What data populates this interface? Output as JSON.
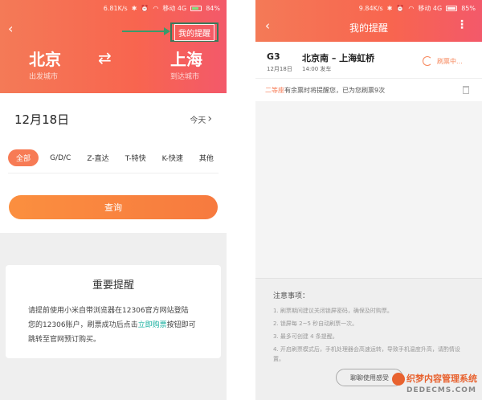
{
  "left": {
    "status": {
      "speed": "6.81K/s",
      "network": "移动 4G",
      "battery": "84%"
    },
    "header": {
      "remind_button": "我的提醒",
      "from_city": "北京",
      "from_label": "出发城市",
      "to_city": "上海",
      "to_label": "到达城市",
      "swap_icon": "⇄"
    },
    "date": {
      "value": "12月18日",
      "today": "今天",
      "chevron": "›"
    },
    "filters": [
      "全部",
      "G/D/C",
      "Z-直达",
      "T-特快",
      "K-快速",
      "其他"
    ],
    "query_button": "查询",
    "notice": {
      "title": "重要提醒",
      "line1": "请提前使用小米自带浏览器在12306官方网站登陆",
      "line2_before": "您的12306账户，刷票成功后点击",
      "line2_link": "立即购票",
      "line2_after": "按钮即可",
      "line3": "跳转至官网预订购买。"
    }
  },
  "right": {
    "status": {
      "speed": "9.84K/s",
      "network": "移动 4G",
      "battery": "85%"
    },
    "header": {
      "title": "我的提醒",
      "more_icon": "⋮",
      "back_icon": "‹"
    },
    "train": {
      "number": "G3",
      "date": "12月18日",
      "route": "北京南 – 上海虹桥",
      "time": "14:00 发车",
      "status": "刷票中..."
    },
    "info": {
      "seat": "二等座",
      "text": "有余票时将提醒您，已为您刷票9次"
    },
    "notes": {
      "title": "注意事项：",
      "items": [
        "1. 刷票期间建议关闭锁屏密码，确保及时购票。",
        "2. 锁屏每 2~5 秒自动刷票一次。",
        "3. 最多可创建 4 条提醒。",
        "4. 开启刷票模式后，手机处理器会高速运转，导致手机温度升高，请酌情设置。"
      ],
      "feedback": "聊聊使用感受"
    }
  },
  "watermark": {
    "title": "织梦内容管理系统",
    "domain": "DEDECMS.COM"
  },
  "colors": {
    "accent": "#f8654f",
    "query": "#f77a3f",
    "link": "#18b0a0",
    "highlight_box": "#3a7a5a"
  }
}
